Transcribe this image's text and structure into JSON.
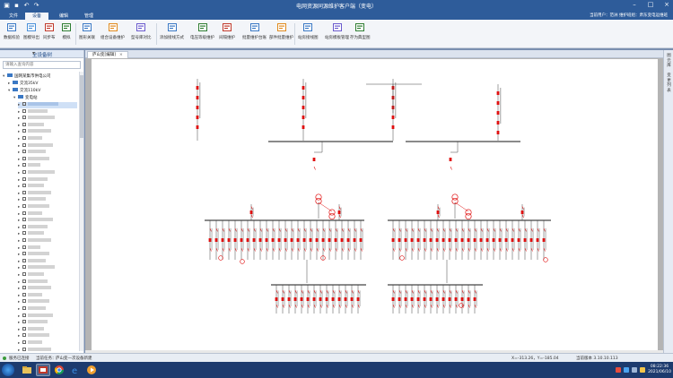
{
  "window": {
    "title": "电网资源同源维护客户端（变电）"
  },
  "menu": {
    "tabs": [
      {
        "label": "文件"
      },
      {
        "label": "设备"
      },
      {
        "label": "编辑"
      },
      {
        "label": "管理"
      }
    ],
    "active_tab": "设备",
    "user_info": "当前用户：范洲 维护班组：肃东变电运维班"
  },
  "ribbon": {
    "buttons": [
      {
        "label": "数据校验",
        "icon": "data-check-icon"
      },
      {
        "label": "图模导出",
        "icon": "export-icon"
      },
      {
        "label": "同步布",
        "icon": "sync-icon"
      },
      {
        "label": "模拟",
        "icon": "simulate-icon"
      },
      {
        "label": "图形关联",
        "icon": "link-icon"
      },
      {
        "label": "组合设备维护",
        "icon": "combo-icon"
      },
      {
        "label": "型号库对比",
        "icon": "compare-icon"
      },
      {
        "label": "添加接线方式",
        "icon": "add-wiring-icon"
      },
      {
        "label": "电压等级维护",
        "icon": "voltage-icon"
      },
      {
        "label": "间隔维护",
        "icon": "bay-icon"
      },
      {
        "label": "批量维护台账",
        "icon": "batch-icon"
      },
      {
        "label": "部件批量维护",
        "icon": "parts-icon"
      },
      {
        "label": "站房接线图",
        "icon": "station-icon"
      },
      {
        "label": "站房模板管理",
        "icon": "template-icon"
      },
      {
        "label": "存为典型图",
        "icon": "save-typical-icon"
      }
    ]
  },
  "left_panel": {
    "title": "全设备树",
    "search_placeholder": "请输入查询内容",
    "tree": [
      {
        "label": "国网某集市供电公司",
        "level": 0,
        "type": "folder",
        "expanded": true
      },
      {
        "label": "交流35kV",
        "level": 1,
        "type": "folder",
        "expanded": false
      },
      {
        "label": "交流110kV",
        "level": 1,
        "type": "folder",
        "expanded": true
      },
      {
        "label": "变电站",
        "level": 2,
        "type": "folder",
        "expanded": true
      }
    ],
    "station_rows": 39,
    "selected_row": 1
  },
  "document": {
    "tab_label": "庐山变[编辑]",
    "close_glyph": "×"
  },
  "right_rail": {
    "items": [
      {
        "label": "图元库"
      },
      {
        "label": "变更列表"
      }
    ]
  },
  "status": {
    "server": "服务已连接",
    "task_label": "当前任务：",
    "task_value": "庐山变一次设备新建",
    "coords": "X=-313.26，Y=-185.04",
    "version": "当前版本 3.10.10.113"
  },
  "taskbar": {
    "clock_time": "08:22:36",
    "clock_date": "2021/06/10"
  },
  "colors": {
    "titlebar": "#2e5c9a",
    "ribbon_bg": "#f3f5f9",
    "diagram_red": "#e01010",
    "diagram_line": "#444444",
    "taskbar": "#1d3b6e"
  }
}
